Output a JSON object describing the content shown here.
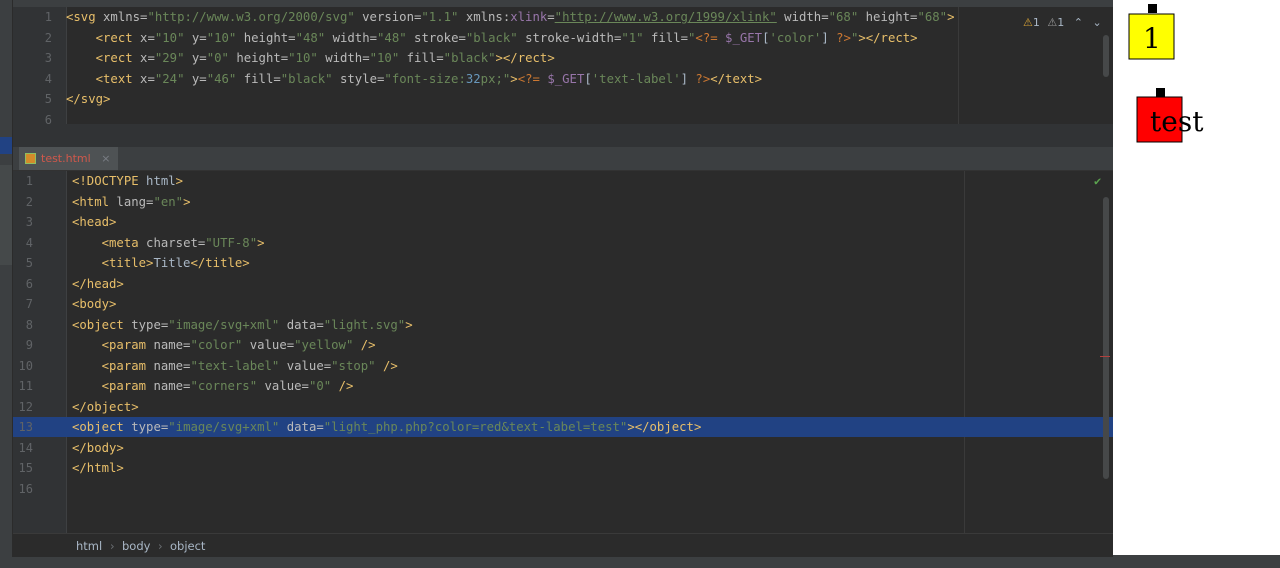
{
  "colors": {
    "bg": "#2b2b2b",
    "tag": "#e8bf6a",
    "attr": "#bababa",
    "value": "#6a8759",
    "php": "#cc7832",
    "var": "#9876aa",
    "number": "#6897bb",
    "selection": "#214283"
  },
  "top_editor": {
    "inspection": {
      "warn1": "1",
      "warn2": "1"
    },
    "lines": [
      {
        "n": "1",
        "tokens": [
          [
            "t-tag",
            "<svg "
          ],
          [
            "t-attr",
            "xmlns="
          ],
          [
            "t-val",
            "\"http://www.w3.org/2000/svg\" "
          ],
          [
            "t-attr",
            "version="
          ],
          [
            "t-val",
            "\"1.1\" "
          ],
          [
            "t-attr",
            "xmlns:"
          ],
          [
            "t-var",
            "xlink"
          ],
          [
            "t-attr",
            "="
          ],
          [
            "t-url",
            "\"http://www.w3.org/1999/xlink\""
          ],
          [
            "t-attr",
            " width="
          ],
          [
            "t-val",
            "\"68\" "
          ],
          [
            "t-attr",
            "height="
          ],
          [
            "t-val",
            "\"68\""
          ],
          [
            "t-tag",
            ">"
          ]
        ]
      },
      {
        "n": "2",
        "tokens": [
          [
            "t-tag",
            "    <rect "
          ],
          [
            "t-attr",
            "x="
          ],
          [
            "t-val",
            "\"10\" "
          ],
          [
            "t-attr",
            "y="
          ],
          [
            "t-val",
            "\"10\" "
          ],
          [
            "t-attr",
            "height="
          ],
          [
            "t-val",
            "\"48\" "
          ],
          [
            "t-attr",
            "width="
          ],
          [
            "t-val",
            "\"48\" "
          ],
          [
            "t-attr",
            "stroke="
          ],
          [
            "t-val",
            "\"black\" "
          ],
          [
            "t-attr",
            "stroke-width="
          ],
          [
            "t-val",
            "\"1\" "
          ],
          [
            "t-attr",
            "fill="
          ],
          [
            "t-val",
            "\""
          ],
          [
            "t-php",
            "<?= "
          ],
          [
            "t-var",
            "$_GET"
          ],
          [
            "t-txt",
            "["
          ],
          [
            "t-str",
            "'color'"
          ],
          [
            "t-txt",
            "] "
          ],
          [
            "t-php",
            "?>"
          ],
          [
            "t-val",
            "\""
          ],
          [
            "t-tag",
            "></rect>"
          ]
        ]
      },
      {
        "n": "3",
        "tokens": [
          [
            "t-tag",
            "    <rect "
          ],
          [
            "t-attr",
            "x="
          ],
          [
            "t-val",
            "\"29\" "
          ],
          [
            "t-attr",
            "y="
          ],
          [
            "t-val",
            "\"0\" "
          ],
          [
            "t-attr",
            "height="
          ],
          [
            "t-val",
            "\"10\" "
          ],
          [
            "t-attr",
            "width="
          ],
          [
            "t-val",
            "\"10\" "
          ],
          [
            "t-attr",
            "fill="
          ],
          [
            "t-val",
            "\"black\""
          ],
          [
            "t-tag",
            "></rect>"
          ]
        ]
      },
      {
        "n": "4",
        "tokens": [
          [
            "t-tag",
            "    <text "
          ],
          [
            "t-attr",
            "x="
          ],
          [
            "t-val",
            "\"24\" "
          ],
          [
            "t-attr",
            "y="
          ],
          [
            "t-val",
            "\"46\" "
          ],
          [
            "t-attr",
            "fill="
          ],
          [
            "t-val",
            "\"black\" "
          ],
          [
            "t-attr",
            "style="
          ],
          [
            "t-val",
            "\"font-size:"
          ],
          [
            "t-num",
            "32"
          ],
          [
            "t-val",
            "px;\""
          ],
          [
            "t-tag",
            ">"
          ],
          [
            "t-php",
            "<?= "
          ],
          [
            "t-var",
            "$_GET"
          ],
          [
            "t-txt",
            "["
          ],
          [
            "t-str",
            "'text-label'"
          ],
          [
            "t-txt",
            "] "
          ],
          [
            "t-php",
            "?>"
          ],
          [
            "t-tag",
            "</text>"
          ]
        ]
      },
      {
        "n": "5",
        "tokens": [
          [
            "t-tag",
            "</svg>"
          ]
        ]
      },
      {
        "n": "6",
        "tokens": []
      }
    ]
  },
  "tab": {
    "label": "test.html",
    "close": "×"
  },
  "bottom_editor": {
    "lines": [
      {
        "n": "1",
        "tokens": [
          [
            "t-doc",
            "<!DOCTYPE "
          ],
          [
            "t-txt",
            "html"
          ],
          [
            "t-doc",
            ">"
          ]
        ]
      },
      {
        "n": "2",
        "tokens": [
          [
            "t-tag",
            "<html "
          ],
          [
            "t-attr",
            "lang="
          ],
          [
            "t-val",
            "\"en\""
          ],
          [
            "t-tag",
            ">"
          ]
        ]
      },
      {
        "n": "3",
        "tokens": [
          [
            "t-tag",
            "<head>"
          ]
        ]
      },
      {
        "n": "4",
        "tokens": [
          [
            "t-tag",
            "    <meta "
          ],
          [
            "t-attr",
            "charset="
          ],
          [
            "t-val",
            "\"UTF-8\""
          ],
          [
            "t-tag",
            ">"
          ]
        ]
      },
      {
        "n": "5",
        "tokens": [
          [
            "t-tag",
            "    <title>"
          ],
          [
            "t-txt",
            "Title"
          ],
          [
            "t-tag",
            "</title>"
          ]
        ]
      },
      {
        "n": "6",
        "tokens": [
          [
            "t-tag",
            "</head>"
          ]
        ]
      },
      {
        "n": "7",
        "tokens": [
          [
            "t-tag",
            "<body>"
          ]
        ]
      },
      {
        "n": "8",
        "tokens": [
          [
            "t-tag",
            "<object "
          ],
          [
            "t-attr",
            "type="
          ],
          [
            "t-val",
            "\"image/svg+xml\" "
          ],
          [
            "t-attr",
            "data="
          ],
          [
            "t-val",
            "\"light.svg\""
          ],
          [
            "t-tag",
            ">"
          ]
        ]
      },
      {
        "n": "9",
        "tokens": [
          [
            "t-tag",
            "    <param "
          ],
          [
            "t-attr",
            "name="
          ],
          [
            "t-val",
            "\"color\" "
          ],
          [
            "t-attr",
            "value="
          ],
          [
            "t-val",
            "\"yellow\" "
          ],
          [
            "t-tag",
            "/>"
          ]
        ]
      },
      {
        "n": "10",
        "tokens": [
          [
            "t-tag",
            "    <param "
          ],
          [
            "t-attr",
            "name="
          ],
          [
            "t-val",
            "\"text-label\" "
          ],
          [
            "t-attr",
            "value="
          ],
          [
            "t-val",
            "\"stop\" "
          ],
          [
            "t-tag",
            "/>"
          ]
        ]
      },
      {
        "n": "11",
        "tokens": [
          [
            "t-tag",
            "    <param "
          ],
          [
            "t-attr",
            "name="
          ],
          [
            "t-val",
            "\"corners\" "
          ],
          [
            "t-attr",
            "value="
          ],
          [
            "t-val",
            "\"0\" "
          ],
          [
            "t-tag",
            "/>"
          ]
        ]
      },
      {
        "n": "12",
        "tokens": [
          [
            "t-tag",
            "</object>"
          ]
        ]
      },
      {
        "n": "13",
        "highlight": true,
        "tokens": [
          [
            "t-tag",
            "<object "
          ],
          [
            "t-attr",
            "type="
          ],
          [
            "t-val",
            "\"image/svg+xml\" "
          ],
          [
            "t-attr",
            "data="
          ],
          [
            "t-val",
            "\"light_php.php?color=red&text-label=test\""
          ],
          [
            "t-tag",
            "></object>"
          ]
        ]
      },
      {
        "n": "14",
        "tokens": [
          [
            "t-tag",
            "</body>"
          ]
        ]
      },
      {
        "n": "15",
        "tokens": [
          [
            "t-tag",
            "</html>"
          ]
        ]
      },
      {
        "n": "16",
        "tokens": []
      }
    ]
  },
  "breadcrumb": [
    "html",
    "body",
    "object"
  ],
  "breadcrumb_sep": "›",
  "preview": {
    "light1": {
      "label": "1",
      "fill": "#ffff00"
    },
    "light2": {
      "label": "test",
      "fill": "#ff0000"
    }
  }
}
